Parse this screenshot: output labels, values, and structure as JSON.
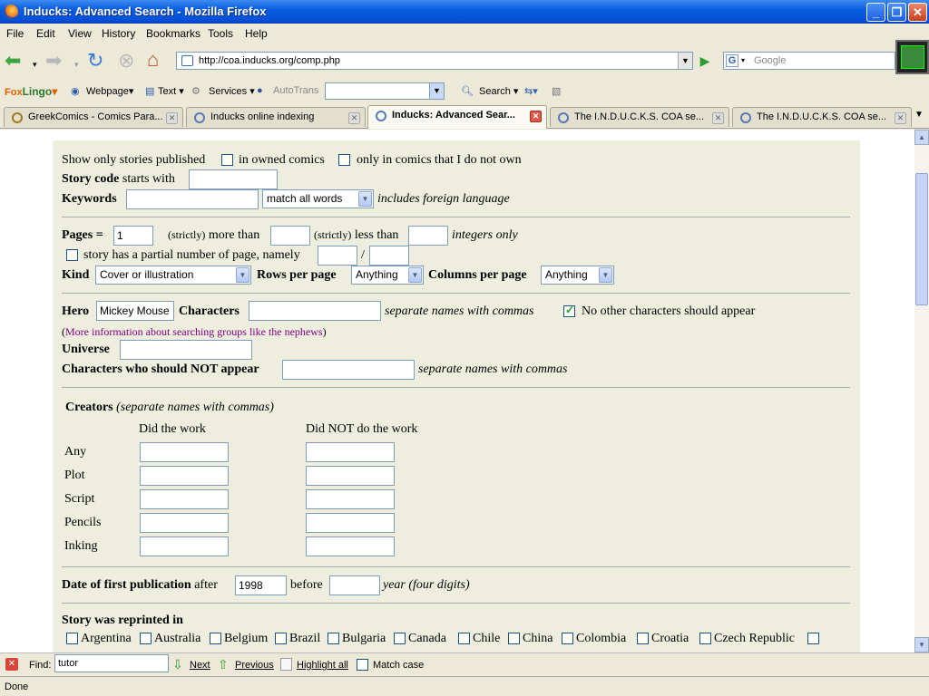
{
  "window": {
    "title": "Inducks: Advanced Search - Mozilla Firefox"
  },
  "menu": [
    "File",
    "Edit",
    "View",
    "History",
    "Bookmarks",
    "Tools",
    "Help"
  ],
  "nav": {
    "url": "http://coa.inducks.org/comp.php",
    "search_placeholder": "Google"
  },
  "foxbar": {
    "logo_a": "Fox",
    "logo_b": "Lingo",
    "webpage": "Webpage",
    "text": "Text",
    "services": "Services",
    "autotrans": "AutoTrans",
    "search": "Search"
  },
  "tabs": [
    {
      "label": "GreekComics - Comics Para..."
    },
    {
      "label": "Inducks online indexing"
    },
    {
      "label": "Inducks: Advanced Sear..."
    },
    {
      "label": "The I.N.D.U.C.K.S. COA se..."
    },
    {
      "label": "The I.N.D.U.C.K.S. COA se..."
    }
  ],
  "form": {
    "show_only": "Show only stories published",
    "in_owned": "in owned comics",
    "only_not_own": "only in comics that I do not own",
    "story_code": "Story code",
    "starts_with": "starts with",
    "keywords": "Keywords",
    "keywords_mode": "match all words",
    "includes_foreign": "includes foreign language",
    "pages": "Pages =",
    "pages_value": "1",
    "strictly_more_a": "(strictly)",
    "strictly_more_b": "more than",
    "strictly_less_a": "(strictly)",
    "strictly_less_b": "less than",
    "integers_only": "integers only",
    "partial_pages": "story has a partial number of page, namely",
    "slash": "/",
    "kind": "Kind",
    "kind_value": "Cover or illustration",
    "rows_per_page": "Rows per page",
    "rows_value": "Anything",
    "columns_per_page": "Columns per page",
    "columns_value": "Anything",
    "hero": "Hero",
    "hero_value": "Mickey Mouse",
    "characters": "Characters",
    "separate_commas": "separate names with commas",
    "no_other_chars": "No other characters should appear",
    "paren_open": "(",
    "more_info_link": "More information about searching groups like the nephews",
    "paren_close": ")",
    "universe": "Universe",
    "chars_not_appear": "Characters who should NOT appear",
    "separate_commas_2": "separate names with commas",
    "creators": "Creators",
    "creators_note": "(separate names with commas)",
    "did_work": "Did the work",
    "did_not_work": "Did NOT do the work",
    "creator_rows": [
      "Any",
      "Plot",
      "Script",
      "Pencils",
      "Inking"
    ],
    "date_first_pub": "Date of first publication",
    "after": "after",
    "after_value": "1998",
    "before": "before",
    "year_four_digits": "year (four digits)",
    "reprinted_in": "Story was reprinted in",
    "countries": [
      "Argentina",
      "Australia",
      "Belgium",
      "Brazil",
      "Bulgaria",
      "Canada",
      "Chile",
      "China",
      "Colombia",
      "Croatia",
      "Czech Republic"
    ]
  },
  "findbar": {
    "find_label": "Find:",
    "find_value": "tutor",
    "next": "Next",
    "previous": "Previous",
    "highlight_all": "Highlight all",
    "match_case": "Match case"
  },
  "status": "Done"
}
